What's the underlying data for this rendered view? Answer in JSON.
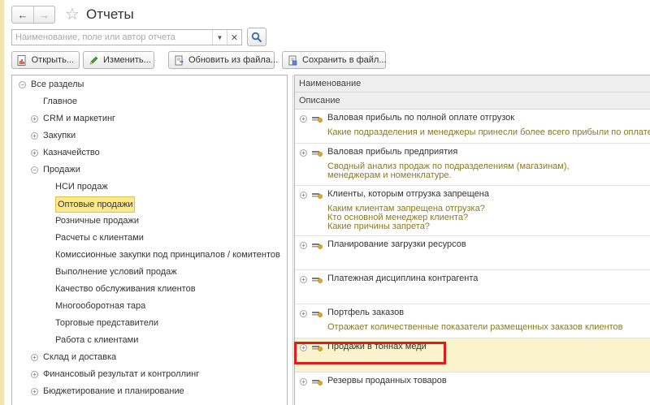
{
  "window": {
    "title": "Отчеты"
  },
  "nav": {
    "back_icon": "←",
    "forward_icon": "→"
  },
  "search": {
    "placeholder": "Наименование, поле или автор отчета",
    "value": ""
  },
  "toolbar": {
    "open_label": "Открыть...",
    "edit_label": "Изменить...",
    "refresh_label": "Обновить из файла...",
    "save_label": "Сохранить в файл..."
  },
  "tree": {
    "items": [
      {
        "label": "Все разделы",
        "level": 0,
        "expander": "minus"
      },
      {
        "label": "Главное",
        "level": 1,
        "expander": "none"
      },
      {
        "label": "CRM и маркетинг",
        "level": 1,
        "expander": "plus"
      },
      {
        "label": "Закупки",
        "level": 1,
        "expander": "plus"
      },
      {
        "label": "Казначейство",
        "level": 1,
        "expander": "plus"
      },
      {
        "label": "Продажи",
        "level": 1,
        "expander": "minus"
      },
      {
        "label": "НСИ продаж",
        "level": 2,
        "expander": "none"
      },
      {
        "label": "Оптовые продажи",
        "level": 2,
        "expander": "none",
        "selected": true
      },
      {
        "label": "Розничные продажи",
        "level": 2,
        "expander": "none"
      },
      {
        "label": "Расчеты с клиентами",
        "level": 2,
        "expander": "none"
      },
      {
        "label": "Комиссионные закупки под принципалов / комитентов",
        "level": 2,
        "expander": "none"
      },
      {
        "label": "Выполнение условий продаж",
        "level": 2,
        "expander": "none"
      },
      {
        "label": "Качество обслуживания клиентов",
        "level": 2,
        "expander": "none"
      },
      {
        "label": "Многооборотная тара",
        "level": 2,
        "expander": "none"
      },
      {
        "label": "Торговые представители",
        "level": 2,
        "expander": "none"
      },
      {
        "label": "Работа с клиентами",
        "level": 2,
        "expander": "none"
      },
      {
        "label": "Склад и доставка",
        "level": 1,
        "expander": "plus"
      },
      {
        "label": "Финансовый результат и контроллинг",
        "level": 1,
        "expander": "plus"
      },
      {
        "label": "Бюджетирование и планирование",
        "level": 1,
        "expander": "plus"
      }
    ]
  },
  "list": {
    "header_name": "Наименование",
    "header_description": "Описание",
    "reports": [
      {
        "title": "Валовая прибыль по полной оплате отгрузок",
        "description": [
          "Какие подразделения и менеджеры принесли более всего прибыли по оплате?"
        ]
      },
      {
        "title": "Валовая прибыль предприятия",
        "description": [
          "Сводный анализ продаж по подразделениям (магазинам),",
          "менеджерам и номенклатуре."
        ]
      },
      {
        "title": "Клиенты, которым отгрузка запрещена",
        "description": [
          "Каким клиентам запрещена отгрузка?",
          "Кто основной менеджер клиента?",
          "Какие причины запрета?"
        ]
      },
      {
        "title": "Планирование загрузки ресурсов",
        "description": []
      },
      {
        "title": "Платежная дисциплина контрагента",
        "description": []
      },
      {
        "title": "Портфель заказов",
        "description": [
          "Отражает количественные показатели размещенных заказов клиентов"
        ]
      },
      {
        "title": "Продажи в тоннах меди",
        "description": [],
        "highlighted": true
      },
      {
        "title": "Резервы проданных товаров",
        "description": []
      }
    ]
  },
  "colors": {
    "selection_fill": "#fde98a",
    "description_text": "#8a7a22",
    "annotation_frame": "#e21a1a",
    "row_highlight": "#fbf3cc"
  }
}
